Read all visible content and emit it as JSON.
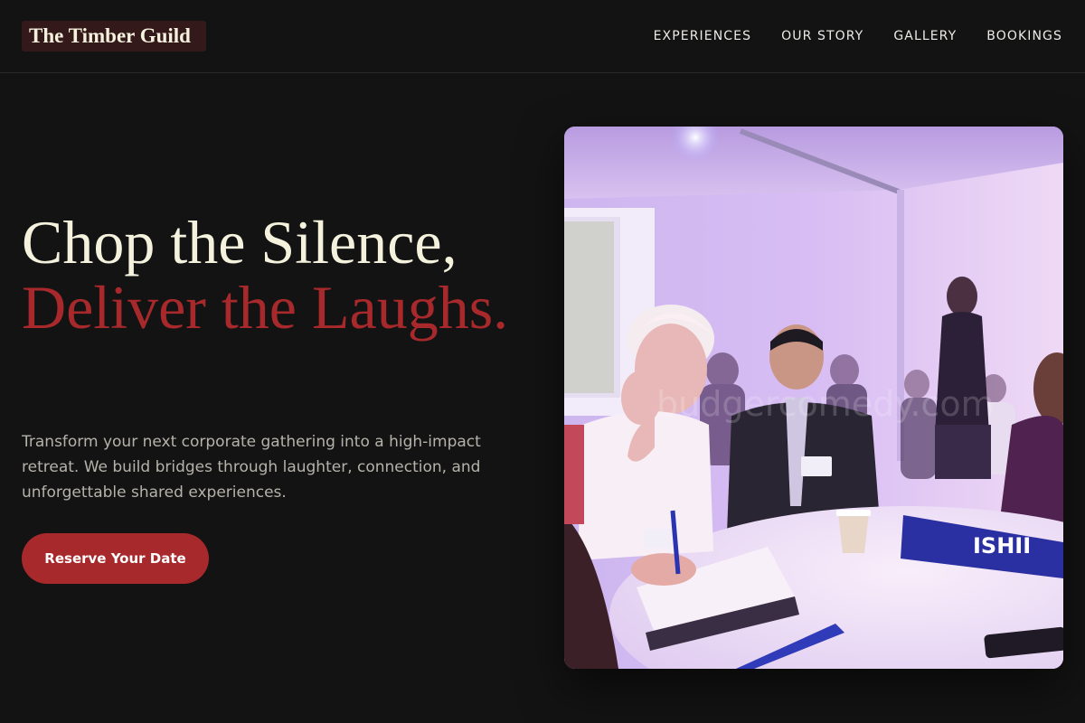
{
  "brand": {
    "name": "The Timber Guild"
  },
  "nav": {
    "items": [
      {
        "label": "EXPERIENCES"
      },
      {
        "label": "OUR STORY"
      },
      {
        "label": "GALLERY"
      },
      {
        "label": "BOOKINGS"
      }
    ]
  },
  "hero": {
    "headline_line1": "Chop the Silence,",
    "headline_line2": "Deliver the Laughs.",
    "subtext": "Transform your next corporate gathering into a high-impact retreat. We build bridges through laughter, connection, and unforgettable shared experiences.",
    "cta_label": "Reserve Your Date"
  },
  "photo": {
    "description_icon": "photo-of-corporate-workshop",
    "table_sign": "ISHII",
    "watermark": "budgercomedy.com"
  },
  "colors": {
    "background": "#141314",
    "accent": "#a8292b",
    "headline_light": "#f4f2dd",
    "logo_bg": "#33191a"
  }
}
